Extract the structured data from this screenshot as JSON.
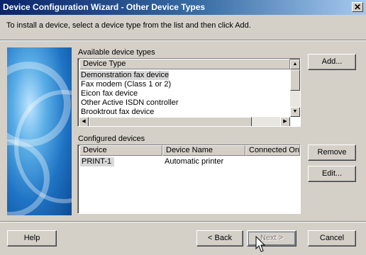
{
  "window": {
    "title": "Device Configuration Wizard - Other Device Types",
    "close_label": "✕"
  },
  "instruction": "To install a device, select a device type from the list and then click Add.",
  "available": {
    "label": "Available device types",
    "column": "Device Type",
    "items": [
      "Demonstration fax device",
      "Fax modem (Class 1 or 2)",
      "Eicon fax device",
      "Other Active ISDN controller",
      "Brooktrout fax device"
    ]
  },
  "configured": {
    "label": "Configured devices",
    "columns": [
      "Device",
      "Device Name",
      "Connected On"
    ],
    "rows": [
      {
        "device": "PRINT-1",
        "name": "Automatic printer",
        "connected": ""
      }
    ]
  },
  "buttons": {
    "add": "Add...",
    "remove": "Remove",
    "edit": "Edit...",
    "help": "Help",
    "back": "< Back",
    "next": "Next >",
    "cancel": "Cancel"
  },
  "icons": {
    "close": "close-icon",
    "scroll_up": "arrow-up-icon",
    "scroll_down": "arrow-down-icon",
    "scroll_left": "arrow-left-icon",
    "scroll_right": "arrow-right-icon",
    "cursor": "mouse-pointer-icon"
  },
  "colors": {
    "titlebar_start": "#0a246a",
    "titlebar_end": "#a6caf0",
    "face": "#d4d0c8",
    "selection": "#d8d8d8"
  }
}
